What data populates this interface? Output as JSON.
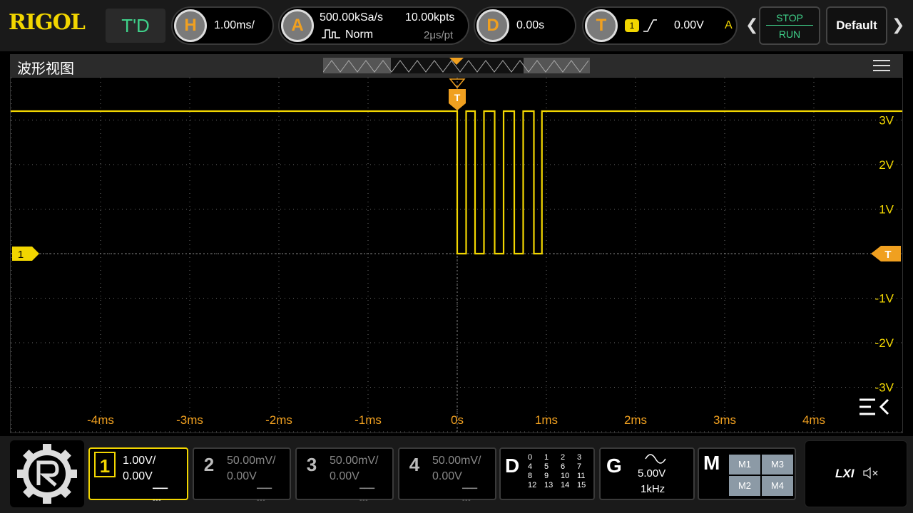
{
  "brand": "RIGOL",
  "mode": "T'D",
  "horizontal": {
    "key": "H",
    "scale": "1.00ms/"
  },
  "acquire": {
    "key": "A",
    "rate": "500.00kSa/s",
    "mode": "Norm",
    "depth": "10.00kpts",
    "per_point": "2μs/pt"
  },
  "delay": {
    "key": "D",
    "value": "0.00s"
  },
  "trigger": {
    "key": "T",
    "source": "1",
    "level": "0.00V",
    "sweep": "A"
  },
  "run_control": {
    "stop": "STOP",
    "run": "RUN"
  },
  "default_button": "Default",
  "view": {
    "title": "波形视图"
  },
  "waveform_markers": {
    "trigger_top": "T",
    "channel_1": "1",
    "trigger_right": "T"
  },
  "y_ticks": [
    "3V",
    "2V",
    "1V",
    "-1V",
    "-2V",
    "-3V"
  ],
  "x_ticks": [
    "-4ms",
    "-3ms",
    "-2ms",
    "-1ms",
    "0s",
    "1ms",
    "2ms",
    "3ms",
    "4ms"
  ],
  "channels": [
    {
      "num": "1",
      "scale": "1.00V/",
      "offset": "0.00V",
      "active": true
    },
    {
      "num": "2",
      "scale": "50.00mV/",
      "offset": "0.00V",
      "active": false
    },
    {
      "num": "3",
      "scale": "50.00mV/",
      "offset": "0.00V",
      "active": false
    },
    {
      "num": "4",
      "scale": "50.00mV/",
      "offset": "0.00V",
      "active": false
    }
  ],
  "digital": {
    "key": "D",
    "lines": [
      "0",
      "1",
      "2",
      "3",
      "4",
      "5",
      "6",
      "7",
      "8",
      "9",
      "10",
      "11",
      "12",
      "13",
      "14",
      "15"
    ]
  },
  "generator": {
    "key": "G",
    "amplitude": "5.00V",
    "frequency": "1kHz"
  },
  "math": {
    "key": "M",
    "items": [
      "M1",
      "M3",
      "M2",
      "M4"
    ]
  },
  "lxi": "LXI",
  "colors": {
    "ch1": "#f2d600",
    "trigger": "#f0a020",
    "accent_green": "#3fd18a",
    "grid": "#6e6e6e"
  }
}
